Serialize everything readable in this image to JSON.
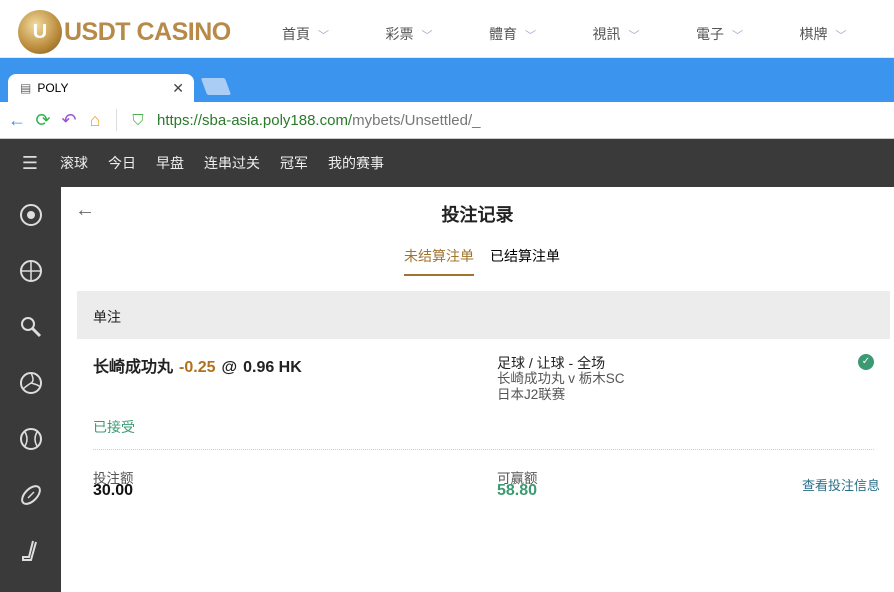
{
  "header": {
    "logo": "USDT CASINO",
    "menu": [
      "首頁",
      "彩票",
      "體育",
      "視訊",
      "電子",
      "棋牌"
    ]
  },
  "browser": {
    "tab_title": "POLY",
    "url_host": "https://sba-asia.poly188.com/",
    "url_path": "mybets/Unsettled/_"
  },
  "nav": {
    "items": [
      "滚球",
      "今日",
      "早盘",
      "连串过关",
      "冠军",
      "我的赛事"
    ]
  },
  "sidebar": {
    "icons": [
      "soccer",
      "basketball",
      "tennis",
      "volleyball",
      "baseball",
      "american-football",
      "hockey"
    ]
  },
  "page": {
    "title": "投注记录",
    "tabs": [
      "未结算注单",
      "已结算注单"
    ],
    "section": "单注"
  },
  "bet": {
    "selection": "长崎成功丸",
    "handicap": "-0.25",
    "at": "@",
    "odds": "0.96 HK",
    "market": "足球 / 让球 - 全场",
    "match": "长崎成功丸 v 栃木SC",
    "league": "日本J2联赛",
    "status": "已接受",
    "stake_label": "投注额",
    "stake": "30.00",
    "win_label": "可赢额",
    "win": "58.80",
    "details_link": "查看投注信息"
  }
}
